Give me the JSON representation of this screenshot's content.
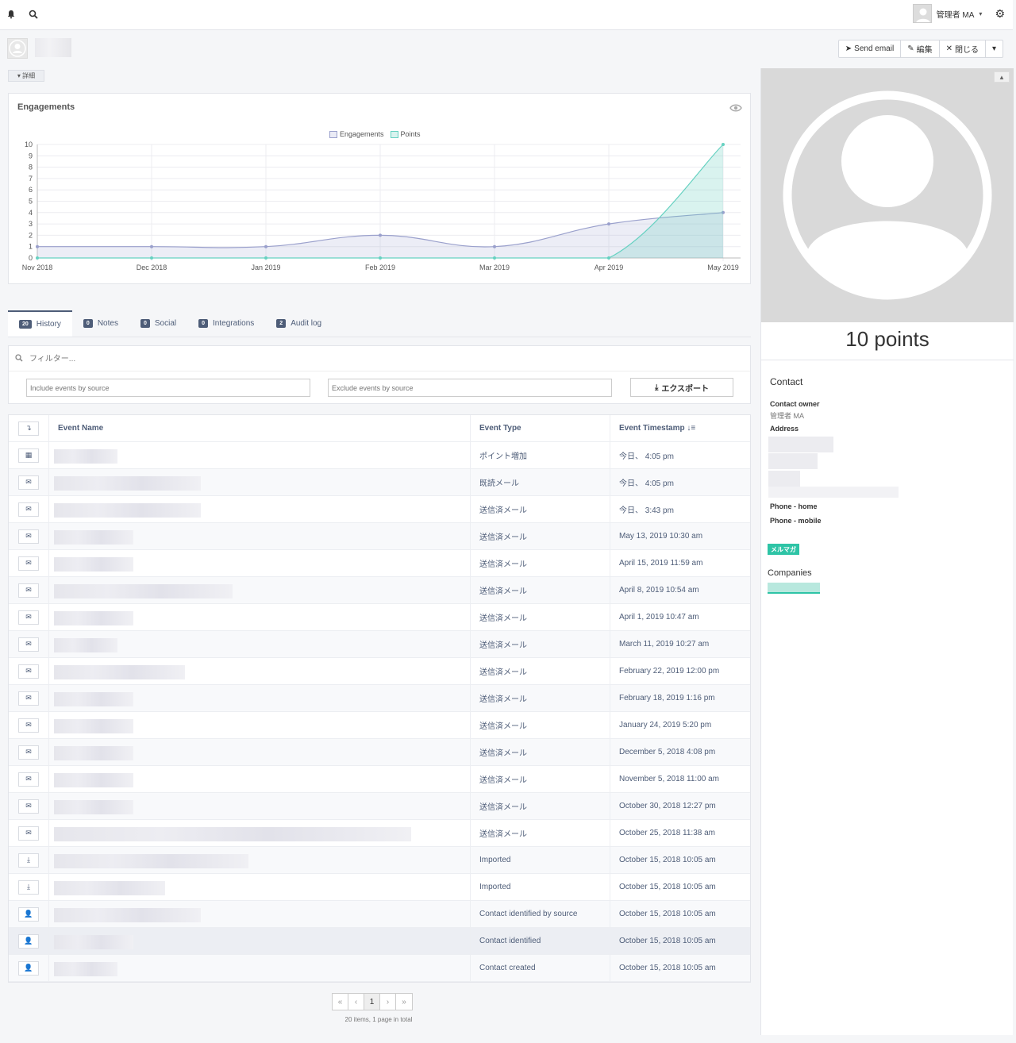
{
  "topbar": {
    "bell_icon": "bell-icon",
    "search_icon": "search-icon",
    "user_name": "管理者 MA",
    "settings_icon": "gear-icon"
  },
  "header": {
    "buttons": {
      "send_email": "Send email",
      "edit": "編集",
      "close": "閉じる"
    },
    "detail_toggle": "▾ 詳細"
  },
  "engagements": {
    "title": "Engagements",
    "legend": [
      "Engagements",
      "Points"
    ]
  },
  "chart_data": {
    "type": "line",
    "title": "Engagements",
    "x": [
      "Nov 2018",
      "Dec 2018",
      "Jan 2019",
      "Feb 2019",
      "Mar 2019",
      "Apr 2019",
      "May 2019"
    ],
    "series": [
      {
        "name": "Engagements",
        "values": [
          1,
          1,
          1,
          2,
          1,
          3,
          4
        ],
        "color": "#9aa0cc",
        "fill": "rgba(170,175,215,0.22)"
      },
      {
        "name": "Points",
        "values": [
          0,
          0,
          0,
          0,
          0,
          0,
          10
        ],
        "color": "#66d1c1",
        "fill": "rgba(102,209,193,0.25)"
      }
    ],
    "ylim": [
      0,
      10
    ],
    "yticks": [
      0,
      1,
      2,
      3,
      4,
      5,
      6,
      7,
      8,
      9,
      10
    ],
    "grid": true,
    "legend_position": "top"
  },
  "tabs": [
    {
      "count": "20",
      "label": "History"
    },
    {
      "count": "0",
      "label": "Notes"
    },
    {
      "count": "0",
      "label": "Social"
    },
    {
      "count": "0",
      "label": "Integrations"
    },
    {
      "count": "2",
      "label": "Audit log"
    }
  ],
  "filter": {
    "placeholder": "フィルター...",
    "include_placeholder": "Include events by source",
    "exclude_placeholder": "Exclude events by source",
    "export_label": "エクスポート"
  },
  "table": {
    "headers": {
      "name": "Event Name",
      "type": "Event Type",
      "timestamp": "Event Timestamp"
    },
    "rows": [
      {
        "icon": "calculator-icon",
        "type": "ポイント増加",
        "timestamp": "今日、 4:05 pm"
      },
      {
        "icon": "envelope-open-icon",
        "type": "既読メール",
        "timestamp": "今日、 4:05 pm"
      },
      {
        "icon": "envelope-icon",
        "type": "送信済メール",
        "timestamp": "今日、 3:43 pm"
      },
      {
        "icon": "envelope-icon",
        "type": "送信済メール",
        "timestamp": "May 13, 2019 10:30 am"
      },
      {
        "icon": "envelope-icon",
        "type": "送信済メール",
        "timestamp": "April 15, 2019 11:59 am"
      },
      {
        "icon": "envelope-icon",
        "type": "送信済メール",
        "timestamp": "April 8, 2019 10:54 am"
      },
      {
        "icon": "envelope-icon",
        "type": "送信済メール",
        "timestamp": "April 1, 2019 10:47 am"
      },
      {
        "icon": "envelope-icon",
        "type": "送信済メール",
        "timestamp": "March 11, 2019 10:27 am"
      },
      {
        "icon": "envelope-icon",
        "type": "送信済メール",
        "timestamp": "February 22, 2019 12:00 pm"
      },
      {
        "icon": "envelope-icon",
        "type": "送信済メール",
        "timestamp": "February 18, 2019 1:16 pm"
      },
      {
        "icon": "envelope-icon",
        "type": "送信済メール",
        "timestamp": "January 24, 2019 5:20 pm"
      },
      {
        "icon": "envelope-icon",
        "type": "送信済メール",
        "timestamp": "December 5, 2018 4:08 pm"
      },
      {
        "icon": "envelope-icon",
        "type": "送信済メール",
        "timestamp": "November 5, 2018 11:00 am"
      },
      {
        "icon": "envelope-icon",
        "type": "送信済メール",
        "timestamp": "October 30, 2018 12:27 pm"
      },
      {
        "icon": "envelope-icon",
        "type": "送信済メール",
        "timestamp": "October 25, 2018 11:38 am"
      },
      {
        "icon": "download-icon",
        "type": "Imported",
        "timestamp": "October 15, 2018 10:05 am"
      },
      {
        "icon": "download-icon",
        "type": "Imported",
        "timestamp": "October 15, 2018 10:05 am"
      },
      {
        "icon": "user-icon",
        "type": "Contact identified by source",
        "timestamp": "October 15, 2018 10:05 am"
      },
      {
        "icon": "user-icon",
        "type": "Contact identified",
        "timestamp": "October 15, 2018 10:05 am"
      },
      {
        "icon": "user-plus-icon",
        "type": "Contact created",
        "timestamp": "October 15, 2018 10:05 am"
      }
    ]
  },
  "pagination": {
    "current": "1",
    "info": "20 items, 1 page in total"
  },
  "sidebar": {
    "points": "10 points",
    "contact_heading": "Contact",
    "owner_label": "Contact owner",
    "owner_value": "管理者 MA",
    "address_label": "Address",
    "phone_home_label": "Phone - home",
    "phone_mobile_label": "Phone - mobile",
    "tag": "メルマガ",
    "companies_heading": "Companies"
  }
}
